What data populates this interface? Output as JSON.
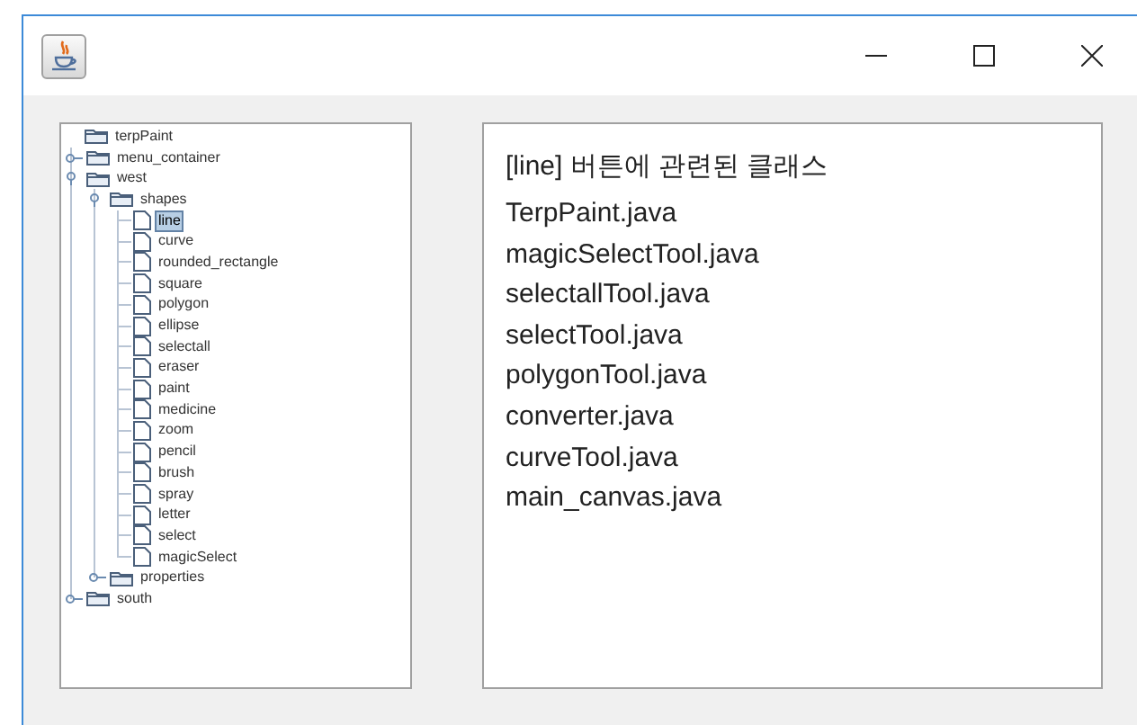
{
  "tree": {
    "label": "terpPaint",
    "kind": "folder",
    "expanded": true,
    "selected": false,
    "children": [
      {
        "label": "menu_container",
        "kind": "folder",
        "expanded": false,
        "selected": false
      },
      {
        "label": "west",
        "kind": "folder",
        "expanded": true,
        "selected": false,
        "children": [
          {
            "label": "shapes",
            "kind": "folder",
            "expanded": true,
            "selected": false,
            "children": [
              {
                "label": "line",
                "kind": "file",
                "selected": true
              },
              {
                "label": "curve",
                "kind": "file",
                "selected": false
              },
              {
                "label": "rounded_rectangle",
                "kind": "file",
                "selected": false
              },
              {
                "label": "square",
                "kind": "file",
                "selected": false
              },
              {
                "label": "polygon",
                "kind": "file",
                "selected": false
              },
              {
                "label": "ellipse",
                "kind": "file",
                "selected": false
              },
              {
                "label": "selectall",
                "kind": "file",
                "selected": false
              },
              {
                "label": "eraser",
                "kind": "file",
                "selected": false
              },
              {
                "label": "paint",
                "kind": "file",
                "selected": false
              },
              {
                "label": "medicine",
                "kind": "file",
                "selected": false
              },
              {
                "label": "zoom",
                "kind": "file",
                "selected": false
              },
              {
                "label": "pencil",
                "kind": "file",
                "selected": false
              },
              {
                "label": "brush",
                "kind": "file",
                "selected": false
              },
              {
                "label": "spray",
                "kind": "file",
                "selected": false
              },
              {
                "label": "letter",
                "kind": "file",
                "selected": false
              },
              {
                "label": "select",
                "kind": "file",
                "selected": false
              },
              {
                "label": "magicSelect",
                "kind": "file",
                "selected": false
              }
            ]
          },
          {
            "label": "properties",
            "kind": "folder",
            "expanded": false,
            "selected": false
          }
        ]
      },
      {
        "label": "south",
        "kind": "folder",
        "expanded": false,
        "selected": false
      }
    ]
  },
  "panel": {
    "heading": "[line] 버튼에 관련된 클래스",
    "items": [
      "TerpPaint.java",
      "magicSelectTool.java",
      "selectallTool.java",
      "selectTool.java",
      "polygonTool.java",
      "converter.java",
      "curveTool.java",
      "main_canvas.java"
    ]
  }
}
